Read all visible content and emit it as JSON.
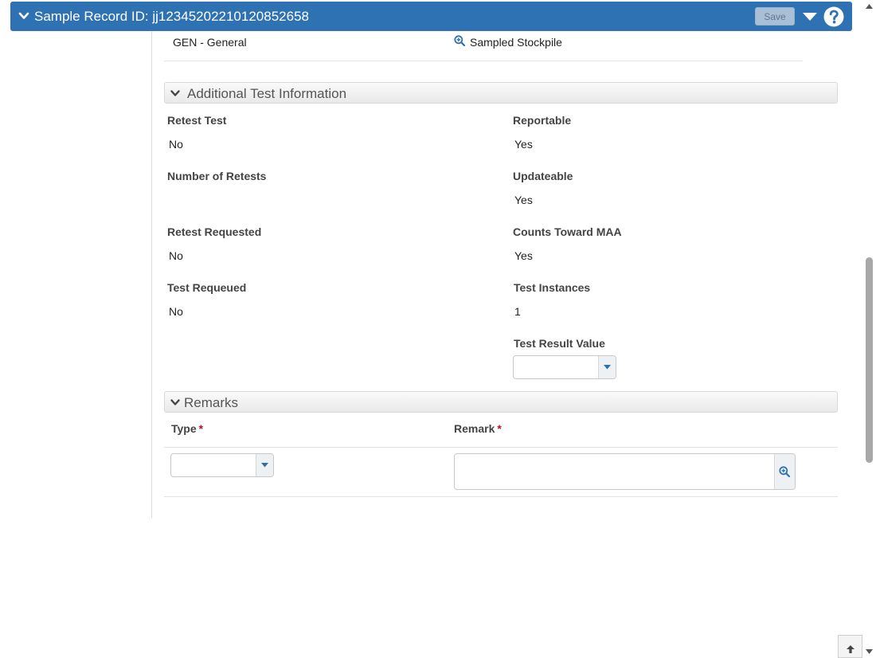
{
  "header": {
    "title": "Sample Record ID: jj12345202210120852658",
    "save_label": "Save"
  },
  "top_row": {
    "left_value": "GEN - General",
    "right_link": "Sampled Stockpile"
  },
  "additional_test_information": {
    "title": "Additional Test Information",
    "fields": {
      "retest_test": {
        "label": "Retest Test",
        "value": "No"
      },
      "reportable": {
        "label": "Reportable",
        "value": "Yes"
      },
      "number_of_retests": {
        "label": "Number of Retests",
        "value": ""
      },
      "updateable": {
        "label": "Updateable",
        "value": "Yes"
      },
      "retest_requested": {
        "label": "Retest Requested",
        "value": "No"
      },
      "counts_toward_maa": {
        "label": "Counts Toward MAA",
        "value": "Yes"
      },
      "test_requeued": {
        "label": "Test Requeued",
        "value": "No"
      },
      "test_instances": {
        "label": "Test Instances",
        "value": "1"
      },
      "test_result_value": {
        "label": "Test Result Value",
        "value": ""
      }
    }
  },
  "remarks": {
    "title": "Remarks",
    "type_label": "Type",
    "remark_label": "Remark",
    "required_marker": "*",
    "type_value": "",
    "remark_value": ""
  },
  "colors": {
    "header_bg": "#2f72b3",
    "required": "#b3141d",
    "link_icon": "#2f72b3"
  },
  "icons": {
    "header_toggle": "chevron-down-icon",
    "menu": "caret-down-icon",
    "help": "question-circle-icon",
    "link": "zoom-in-icon",
    "scroll_top": "arrow-up-icon"
  }
}
